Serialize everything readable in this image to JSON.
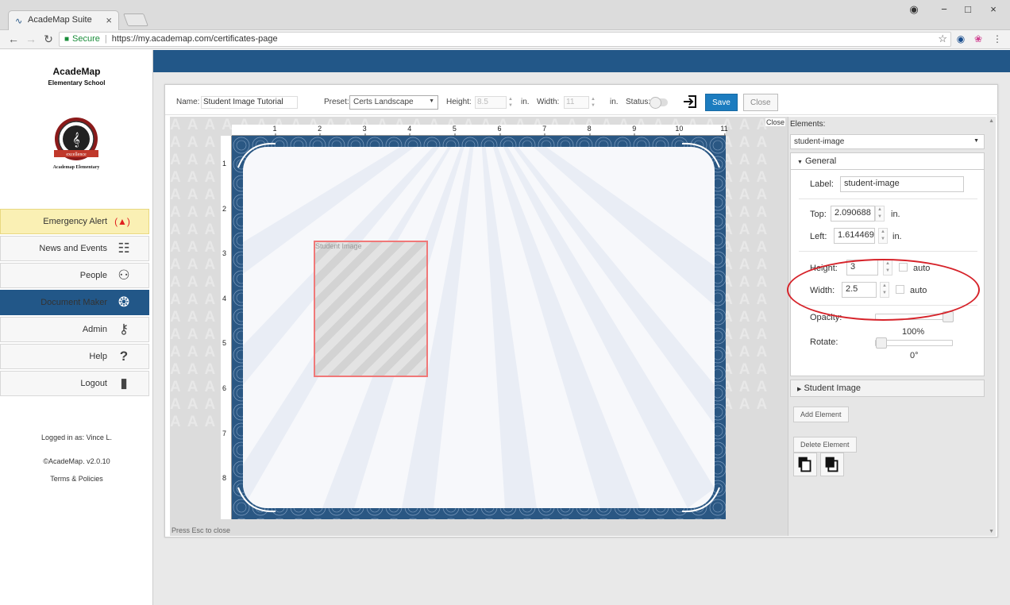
{
  "browser": {
    "tab_title": "AcadeMap Suite",
    "tab_close": "×",
    "secure_label": "Secure",
    "url": "https://my.academap.com/certificates-page",
    "window_controls": [
      "−",
      "□",
      "×"
    ]
  },
  "sidebar": {
    "brand": "AcadeMap",
    "subtitle": "Elementary School",
    "logo_ribbon": "excellence",
    "logo_caption": "Academap Elementary",
    "items": [
      {
        "label": "Emergency Alert",
        "icon": "(▲)"
      },
      {
        "label": "News and Events",
        "icon": "☷"
      },
      {
        "label": "People",
        "icon": "⚇"
      },
      {
        "label": "Document Maker",
        "icon": "❂"
      },
      {
        "label": "Admin",
        "icon": "⚷"
      },
      {
        "label": "Help",
        "icon": "?"
      },
      {
        "label": "Logout",
        "icon": "▮"
      }
    ],
    "logged_in": "Logged in as: Vince L.",
    "version": "©AcadeMap. v2.0.10",
    "terms": "Terms & Policies"
  },
  "editor": {
    "name_label": "Name:",
    "name_value": "Student Image Tutorial",
    "preset_label": "Preset:",
    "preset_value": "Certs Landscape",
    "height_label": "Height:",
    "height_value": "8.5",
    "width_label": "Width:",
    "width_value": "11",
    "unit": "in.",
    "status_label": "Status:",
    "save_label": "Save",
    "close_label": "Close",
    "ruler_h": [
      "1",
      "2",
      "3",
      "4",
      "5",
      "6",
      "7",
      "8",
      "9",
      "10",
      "11"
    ],
    "ruler_v": [
      "1",
      "2",
      "3",
      "4",
      "5",
      "6",
      "7",
      "8"
    ],
    "watermark_letter": "A",
    "student_image_label": "Student Image",
    "esc_note": "Press Esc to close",
    "close_link": "Close"
  },
  "props": {
    "elements_label": "Elements:",
    "selected_element": "student-image",
    "general_label": "General",
    "label_label": "Label:",
    "label_value": "student-image",
    "top_label": "Top:",
    "top_value": "2.090688",
    "left_label": "Left:",
    "left_value": "1.614469",
    "unit": "in.",
    "height_label": "Height:",
    "height_value": "3",
    "width_label": "Width:",
    "width_value": "2.5",
    "auto_label": "auto",
    "opacity_label": "Opacity:",
    "opacity_value": "100%",
    "opacity_fraction": 1.0,
    "rotate_label": "Rotate:",
    "rotate_value": "0°",
    "rotate_fraction": 0.0,
    "student_image_section": "Student Image",
    "add_element": "Add Element",
    "delete_element": "Delete Element"
  },
  "colors": {
    "brand_blue": "#225788",
    "alert_yellow": "#faf0b4",
    "save_blue": "#1c7cbf",
    "annotation_red": "#d6232a"
  }
}
